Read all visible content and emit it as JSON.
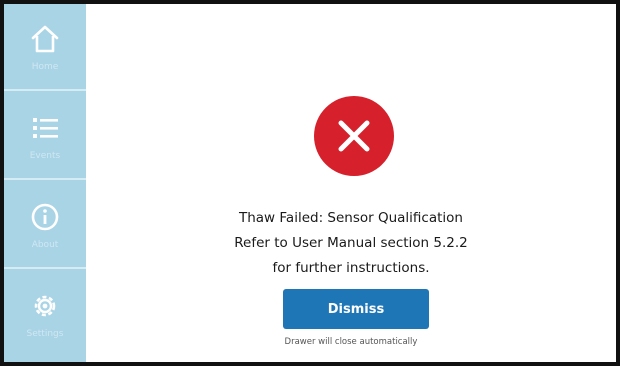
{
  "sidebar": {
    "items": [
      {
        "icon": "home-icon",
        "label": "Home"
      },
      {
        "icon": "list-icon",
        "label": "Events"
      },
      {
        "icon": "info-icon",
        "label": "About"
      },
      {
        "icon": "gear-icon",
        "label": "Settings"
      }
    ]
  },
  "dialog": {
    "status_icon": "error-x-icon",
    "line1": "Thaw Failed: Sensor Qualification",
    "line2": "Refer to User Manual section 5.2.2",
    "line3": "for further instructions.",
    "dismiss_label": "Dismiss",
    "note": "Drawer will close automatically"
  },
  "colors": {
    "sidebar": "#a9d4e6",
    "error_red": "#d6202b",
    "button_blue": "#1f76b6"
  }
}
